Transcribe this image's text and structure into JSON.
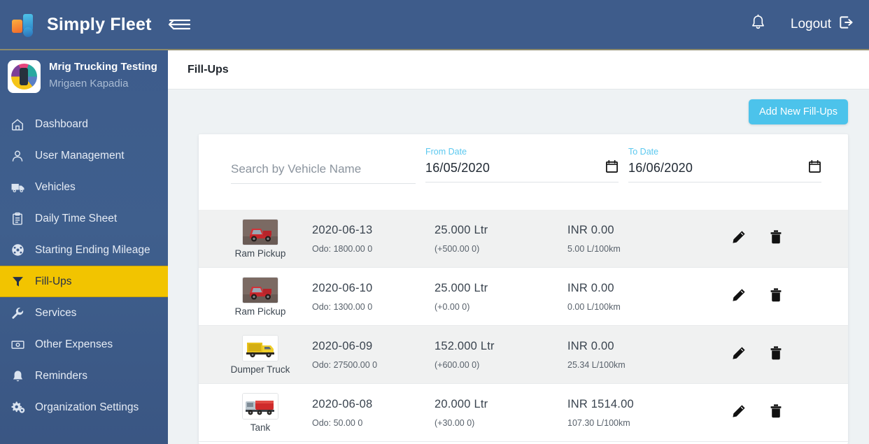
{
  "topbar": {
    "brand": "Simply Fleet",
    "menu_toggle_label": "Toggle sidebar",
    "notifications_label": "Notifications",
    "logout_label": "Logout"
  },
  "sidebar": {
    "org_name": "Mrig Trucking Testing",
    "org_user": "Mrigaen Kapadia",
    "items": [
      {
        "label": "Dashboard",
        "icon": "home-icon",
        "active": false
      },
      {
        "label": "User Management",
        "icon": "user-icon",
        "active": false
      },
      {
        "label": "Vehicles",
        "icon": "truck-icon",
        "active": false
      },
      {
        "label": "Daily Time Sheet",
        "icon": "clipboard-icon",
        "active": false
      },
      {
        "label": "Starting Ending Mileage",
        "icon": "speedometer-icon",
        "active": false
      },
      {
        "label": "Fill-Ups",
        "icon": "funnel-icon",
        "active": true
      },
      {
        "label": "Services",
        "icon": "wrench-icon",
        "active": false
      },
      {
        "label": "Other Expenses",
        "icon": "money-icon",
        "active": false
      },
      {
        "label": "Reminders",
        "icon": "bell-icon",
        "active": false
      },
      {
        "label": "Organization Settings",
        "icon": "gears-icon",
        "active": false
      }
    ]
  },
  "page": {
    "title": "Fill-Ups",
    "add_button": "Add New Fill-Ups"
  },
  "filters": {
    "search_placeholder": "Search by Vehicle Name",
    "search_value": "",
    "from_label": "From Date",
    "from_value": "16/05/2020",
    "to_label": "To Date",
    "to_value": "16/06/2020"
  },
  "table": {
    "rows": [
      {
        "vehicle": "Ram Pickup",
        "thumb": "red-pickup",
        "date": "2020-06-13",
        "odometer": "Odo: 1800.00 0",
        "fuel": "25.000 Ltr",
        "fuel_delta": "(+500.00 0)",
        "cost": "INR 0.00",
        "efficiency": "5.00 L/100km"
      },
      {
        "vehicle": "Ram Pickup",
        "thumb": "red-pickup",
        "date": "2020-06-10",
        "odometer": "Odo: 1300.00 0",
        "fuel": "25.000 Ltr",
        "fuel_delta": "(+0.00 0)",
        "cost": "INR 0.00",
        "efficiency": "0.00 L/100km"
      },
      {
        "vehicle": "Dumper Truck",
        "thumb": "yellow-dumper",
        "date": "2020-06-09",
        "odometer": "Odo: 27500.00 0",
        "fuel": "152.000 Ltr",
        "fuel_delta": "(+600.00 0)",
        "cost": "INR 0.00",
        "efficiency": "25.34 L/100km"
      },
      {
        "vehicle": "Tank",
        "thumb": "red-tanker",
        "date": "2020-06-08",
        "odometer": "Odo: 50.00 0",
        "fuel": "20.000 Ltr",
        "fuel_delta": "(+30.00 0)",
        "cost": "INR 1514.00",
        "efficiency": "107.30 L/100km"
      }
    ],
    "edit_label": "Edit",
    "delete_label": "Delete"
  },
  "colors": {
    "topbar": "#3e5c8b",
    "sidebar": "#3d5c8c",
    "active_nav": "#f2c400",
    "accent": "#4cc3eb",
    "date_label": "#5bc8ef",
    "page_bg": "#eef2f4"
  }
}
